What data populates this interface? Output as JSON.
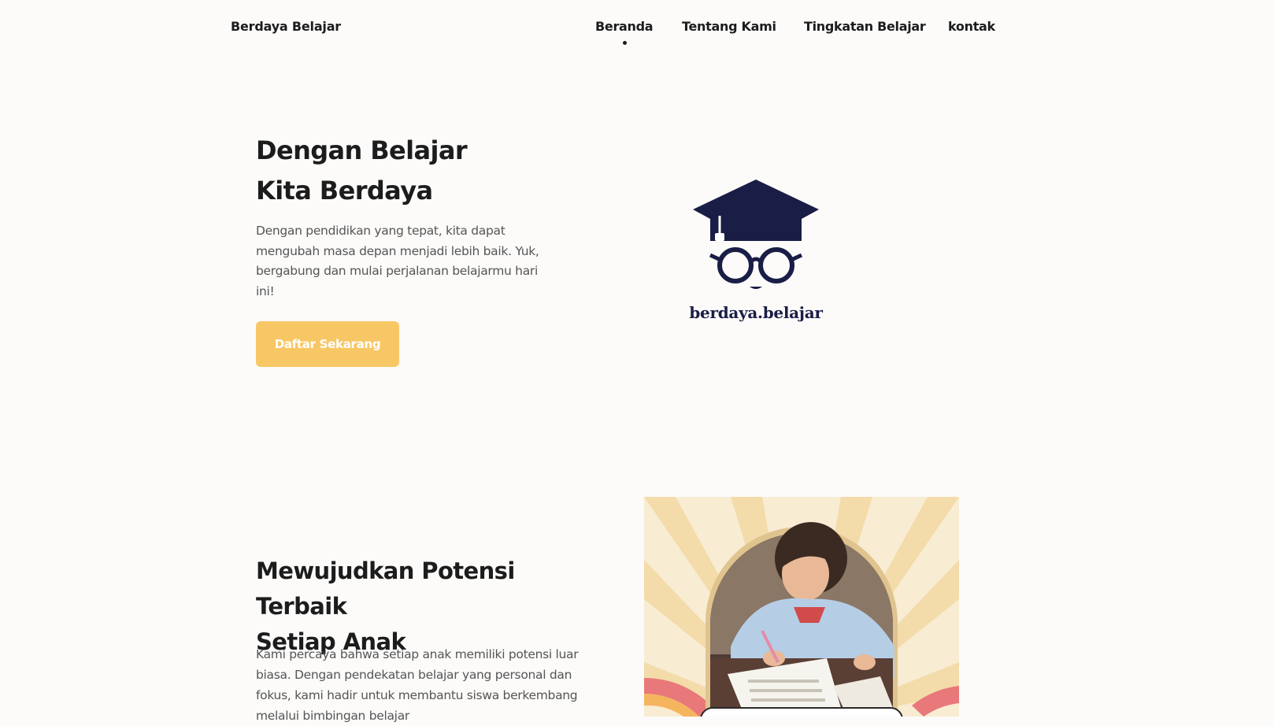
{
  "header": {
    "brand": "Berdaya Belajar",
    "nav": [
      {
        "label": "Beranda",
        "active": true
      },
      {
        "label": "Tentang Kami",
        "active": false
      },
      {
        "label": "Tingkatan Belajar",
        "active": false
      },
      {
        "label": "kontak",
        "active": false
      }
    ]
  },
  "hero": {
    "title_line1": "Dengan Belajar",
    "title_line2": "Kita Berdaya",
    "description": "Dengan pendidikan yang tepat, kita dapat mengubah masa depan menjadi lebih baik. Yuk, bergabung dan mulai perjalanan belajarmu hari ini!",
    "cta_label": "Daftar Sekarang",
    "logo_text": "berdaya.belajar"
  },
  "section": {
    "title_line1": "Mewujudkan Potensi Terbaik",
    "title_line2": "Setiap Anak",
    "description": "Kami percaya bahwa setiap anak memiliki potensi luar biasa. Dengan pendekatan belajar yang personal dan fokus, kami hadir untuk membantu siswa berkembang melalui bimbingan belajar"
  },
  "colors": {
    "background": "#fcfbfa",
    "accent": "#f8c765",
    "logo_navy": "#1a1d45",
    "text_muted": "#555555"
  }
}
